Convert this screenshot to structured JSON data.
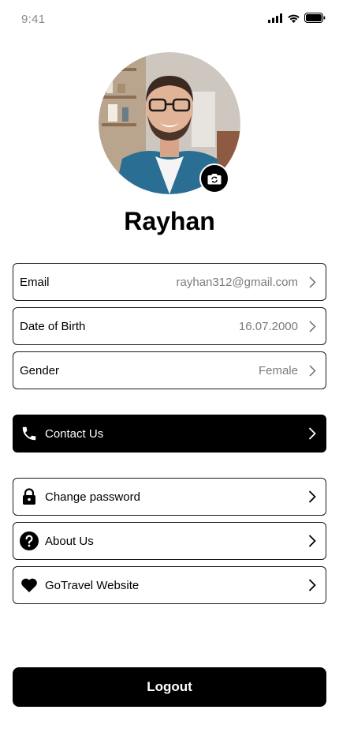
{
  "status_bar": {
    "time": "9:41"
  },
  "profile": {
    "name": "Rayhan"
  },
  "info_rows": [
    {
      "label": "Email",
      "value": "rayhan312@gmail.com"
    },
    {
      "label": "Date of Birth",
      "value": "16.07.2000"
    },
    {
      "label": "Gender",
      "value": "Female"
    }
  ],
  "contact": {
    "label": "Contact Us",
    "icon": "phone-icon"
  },
  "menu": [
    {
      "label": "Change password",
      "icon": "lock-icon"
    },
    {
      "label": "About Us",
      "icon": "question-circle-icon"
    },
    {
      "label": "GoTravel Website",
      "icon": "heart-icon"
    }
  ],
  "logout": {
    "label": "Logout"
  },
  "colors": {
    "primary": "#000000",
    "muted_text": "#7b7b7b",
    "background": "#ffffff"
  }
}
